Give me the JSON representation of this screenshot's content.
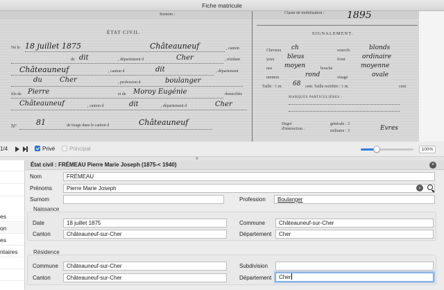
{
  "window": {
    "title": "Fiche matricule"
  },
  "document": {
    "header_label": "Sornom :",
    "classe_label": "Classe de mobilisation :",
    "classe_value": "1895",
    "etat_civil_heading": "ÉTAT CIVIL.",
    "signalement_heading": "SIGNALEMENT.",
    "marques_heading": "MARQUES PARTICULIÈRES :",
    "ne_le_label": "Né le",
    "ne_le_value": "18 juillet 1875",
    "a_value": "Châteauneuf",
    "canton_label": ", canton",
    "de_label": "de",
    "de_value": "dit",
    "departement_label": ", département d",
    "departement_value": "Cher",
    "residant_label": ", résidant",
    "residant_a_value": "Châteauneuf",
    "canton_de_label": ", canton d",
    "canton_de_value": "dit",
    "dept2_label": ", département",
    "dept2_prefix_value": "du",
    "dept2_value": "Cher",
    "profession_label": ", profession d",
    "profession_value": "boulanger",
    "fils_label": "fils de",
    "father_value": "Pierre",
    "mother_label": "et de",
    "mother_value": "Moroy Eugénie",
    "domicilies_label": "domiciliés",
    "dom_a_value": "Châteauneuf",
    "canton3_label": ", canton d",
    "canton3_value": "dit",
    "dept3_label": ", département d",
    "dept3_value": "Cher",
    "no_label": "N°",
    "tirage_value": "81",
    "tirage_label": "de tirage dans le canton d",
    "tirage_canton_value": "Châteauneuf",
    "cheveux_label": "Cheveux",
    "cheveux_value": "ch",
    "sourcils_label": "sourcils",
    "sourcils_value": "blonds",
    "yeux_label": "yeux",
    "yeux_value": "bleus",
    "front_label": "front",
    "front_value": "ordinaire",
    "nez_label": "nez",
    "nez_value": "moyen",
    "bouche_label": "bouche",
    "bouche_value": "moyenne",
    "menton_label": "menton",
    "menton_value": "rond",
    "visage_label": "visage",
    "visage_value": "ovale",
    "taille_label": "Taille : 1 m.",
    "taille_value": "68",
    "taille_rect_label": "cent. Taille rectifiée : 1 m.",
    "taille_rect_unit": "cent.",
    "degre_label": "Degré d'instruction :",
    "generale_label": "générale : 3",
    "militaire_label": "militaire : 3",
    "generale_value": "3",
    "militaire_value": "Evres"
  },
  "toolbar": {
    "page_indicator": "1/4",
    "prive_label": "Privé",
    "prive_checked": true,
    "principal_label": "Principal",
    "principal_checked": true,
    "zoom_label": "100%",
    "zoom_fraction": 0.3
  },
  "sidebar": {
    "items": [
      "",
      "",
      "",
      "es",
      "on",
      "es",
      "ntaires",
      "",
      "",
      ""
    ],
    "selected_index": 4
  },
  "form": {
    "title": "État civil : FRÉMEAU Pierre Marie Joseph (1875-< 1940)",
    "close_icon": "×",
    "nom_label": "Nom",
    "nom_value": "FRÉMEAU",
    "prenoms_label": "Prénoms",
    "prenoms_value": "Pierre Marie Joseph",
    "surnom_label": "Surnom",
    "surnom_value": "",
    "profession_label": "Profession",
    "profession_value": "Boulanger",
    "naissance": {
      "title": "Naissance",
      "date_label": "Date",
      "date_value": "18 juillet 1875",
      "commune_label": "Commune",
      "commune_value": "Châteauneuf-sur-Cher",
      "canton_label": "Canton",
      "canton_value": "Châteauneuf-sur-Cher",
      "departement_label": "Département",
      "departement_value": "Cher"
    },
    "residence": {
      "title": "Résidence",
      "commune_label": "Commune",
      "commune_value": "Châteauneuf-sur-Cher",
      "subdivision_label": "Subdivision",
      "subdivision_value": "",
      "canton_label": "Canton",
      "canton_value": "Châteauneuf-sur-Cher",
      "departement_label": "Département",
      "departement_value": "Cher"
    }
  },
  "colors": {
    "accent": "#2f7de1",
    "focus_ring": "#6aa3e8"
  }
}
